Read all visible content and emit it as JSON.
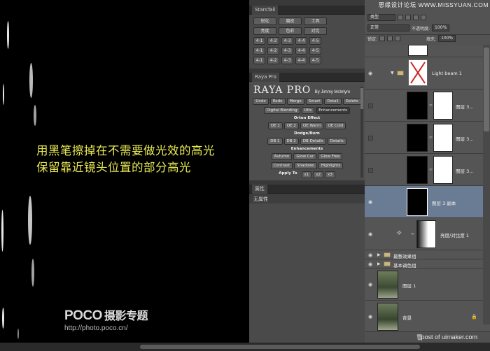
{
  "caption": {
    "line1": "用黑笔擦掉在不需要做光效的高光",
    "line2": "保留靠近镜头位置的部分高光"
  },
  "watermark": {
    "logo": "POCO",
    "logo_cn": "摄影专题",
    "url": "http://photo.poco.cn/"
  },
  "brand": "思缘设计论坛 WWW.MISSYUAN.COM",
  "starstail": {
    "tab": "StarsTail",
    "row1": [
      "锐化",
      "磨皮",
      "工具"
    ],
    "row2": [
      "亮度",
      "色彩",
      "对比"
    ],
    "small_rows": [
      [
        "4-1",
        "4-2",
        "4-3",
        "4-4",
        "4-5"
      ],
      [
        "4-1",
        "4-2",
        "4-3",
        "4-4",
        "4-5"
      ],
      [
        "4-1",
        "4-2",
        "4-3",
        "4-4",
        "4-5"
      ]
    ]
  },
  "raya": {
    "tab": "Raya Pro",
    "title": "RAYA PRO",
    "by": "By Jimmy McIntyre",
    "row1": [
      "Undo",
      "Redo",
      "Merge",
      "Smart",
      "Detail",
      "Delete"
    ],
    "row2": [
      "Digital Blending",
      "Utls",
      "Enhancements"
    ],
    "orton_head": "Orton Effect",
    "orton": [
      "OE 1",
      "OE 2",
      "OE Warm",
      "OE Cold"
    ],
    "dodge_head": "Dodge/Burn",
    "dodge": [
      "DB 1",
      "DB 2",
      "DB Details",
      "Details"
    ],
    "enh_head": "Enhancements",
    "enh1": [
      "Autumn",
      "Glow Cur",
      "Glow Free"
    ],
    "enh2": [
      "Contrast",
      "Shadows",
      "Highlights"
    ],
    "apply": "Apply To",
    "apply_btns": [
      "x1",
      "x2",
      "x3"
    ]
  },
  "props": {
    "tab": "属性",
    "sub": "无属性"
  },
  "layers_toolbar": {
    "kind": "类型",
    "blend": "正常",
    "opacity_label": "不透明度:",
    "opacity": "100%",
    "lock_label": "锁定:",
    "fill_label": "填充:",
    "fill": "100%"
  },
  "layers": [
    {
      "name": "Light beam 1"
    },
    {
      "name": "图层 3..."
    },
    {
      "name": "图层 3..."
    },
    {
      "name": "图层 3..."
    },
    {
      "name": "图层 3 副本"
    },
    {
      "name": "亮度/对比度 1"
    },
    {
      "name": "最整效果组"
    },
    {
      "name": "基本调色组"
    },
    {
      "name": "图层 1"
    },
    {
      "name": "背景"
    }
  ],
  "footer_text": "post of uimaker.com"
}
